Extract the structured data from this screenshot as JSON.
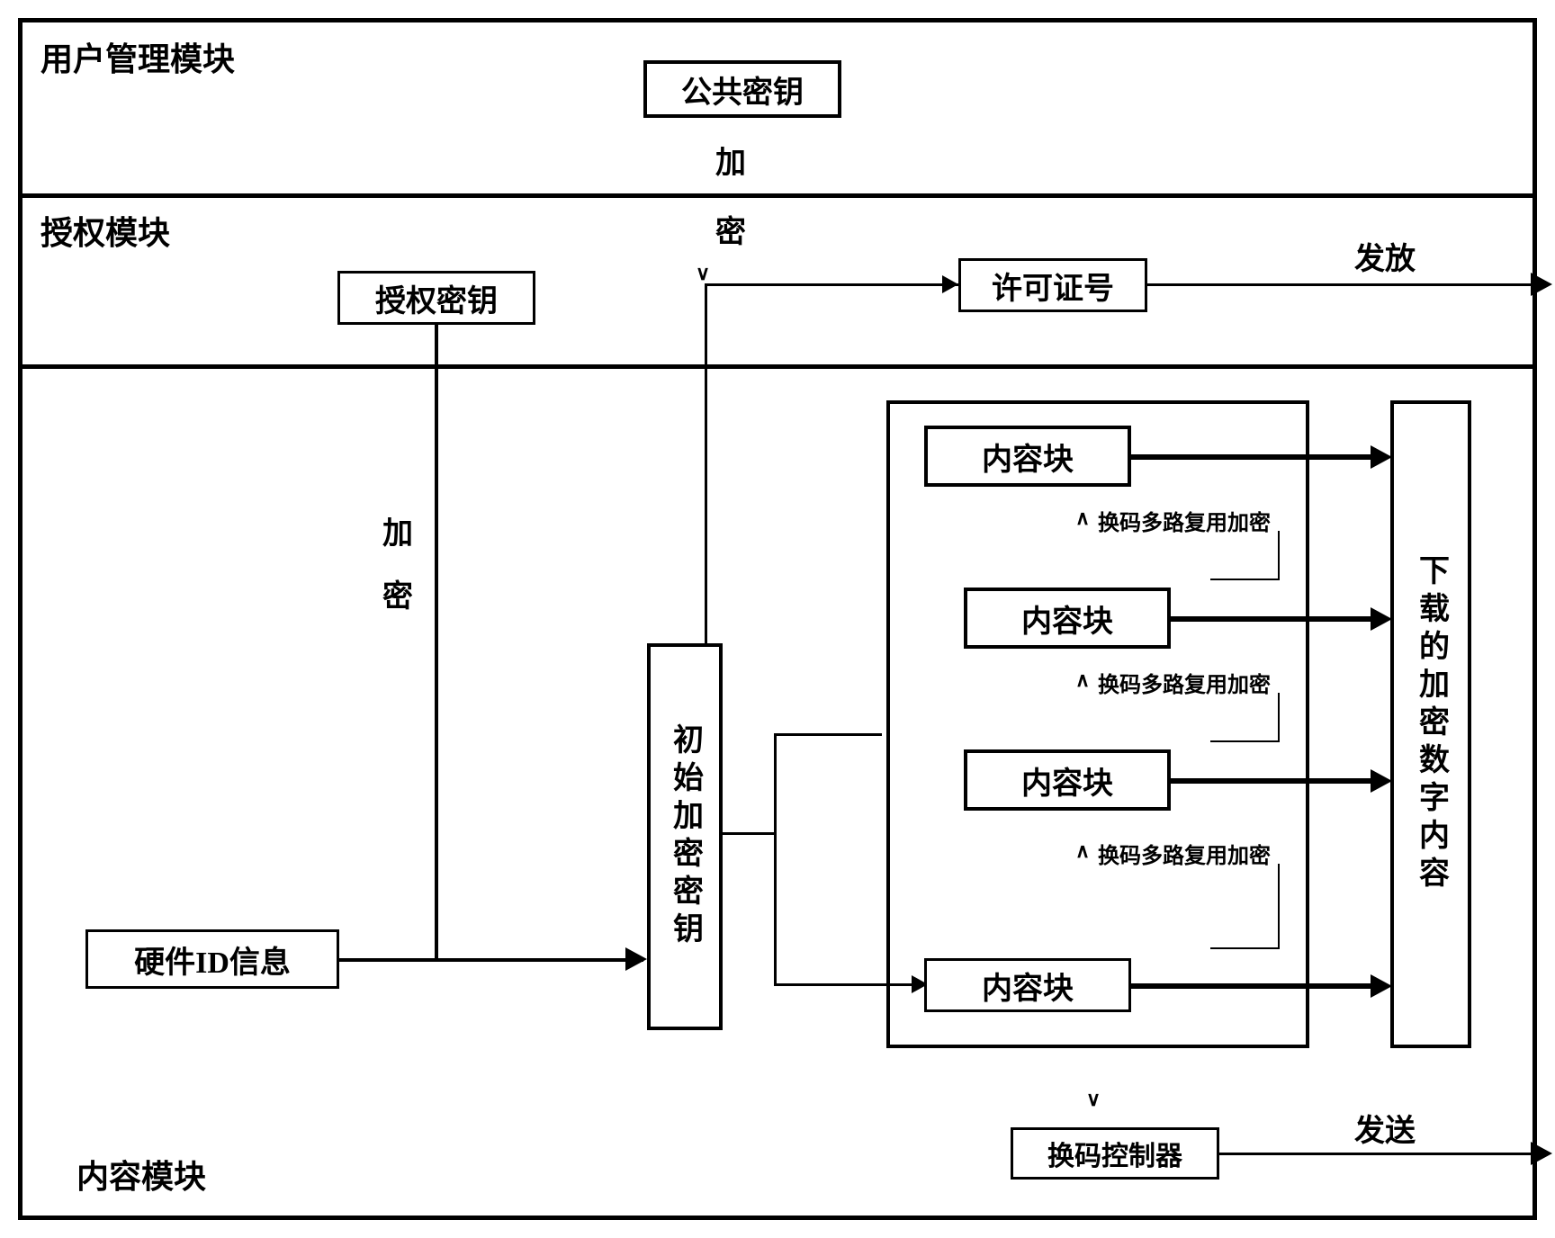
{
  "modules": {
    "user_mgmt": "用户管理模块",
    "auth": "授权模块",
    "content": "内容模块"
  },
  "boxes": {
    "public_key": "公共密钥",
    "auth_key": "授权密钥",
    "license_no": "许可证号",
    "hardware_id": "硬件ID信息",
    "init_enc_key": "初始加密密钥",
    "content_block": "内容块",
    "download_enc": "下载的加密数字内容",
    "swap_controller": "换码控制器"
  },
  "labels": {
    "encrypt": "加密",
    "encrypt_v1": "加",
    "encrypt_v2": "密",
    "issue": "发放",
    "send": "发送",
    "swap_mux_enc": "换码多路复用加密",
    "caret_up": "∧",
    "caret_down": "∨"
  }
}
